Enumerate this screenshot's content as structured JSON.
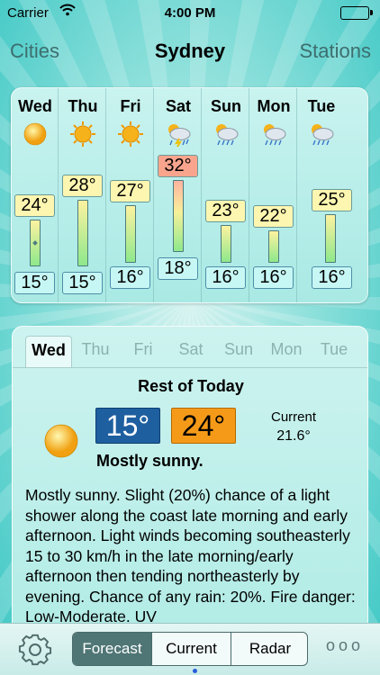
{
  "status_bar": {
    "carrier": "Carrier",
    "time": "4:00 PM"
  },
  "nav": {
    "left": "Cities",
    "title": "Sydney",
    "right": "Stations"
  },
  "week": [
    {
      "day": "Wed",
      "icon": "sun-icon",
      "high": "24°",
      "low": "15°"
    },
    {
      "day": "Thu",
      "icon": "sun-icon",
      "high": "28°",
      "low": "15°"
    },
    {
      "day": "Fri",
      "icon": "sun-icon",
      "high": "27°",
      "low": "16°"
    },
    {
      "day": "Sat",
      "icon": "thunderstorm-icon",
      "high": "32°",
      "low": "18°"
    },
    {
      "day": "Sun",
      "icon": "rain-cloud-icon",
      "high": "23°",
      "low": "16°"
    },
    {
      "day": "Mon",
      "icon": "rain-cloud-icon",
      "high": "22°",
      "low": "16°"
    },
    {
      "day": "Tue",
      "icon": "rain-cloud-icon",
      "high": "25°",
      "low": "16°"
    }
  ],
  "detail": {
    "tabs": [
      "Wed",
      "Thu",
      "Fri",
      "Sat",
      "Sun",
      "Mon",
      "Tue"
    ],
    "active_tab": "Wed",
    "period": "Rest of Today",
    "low": "15°",
    "high": "24°",
    "current_label": "Current",
    "current_value": "21.6°",
    "condition": "Mostly sunny.",
    "forecast": "Mostly sunny. Slight (20%) chance of a light shower along the coast late morning and early afternoon. Light winds becoming southeasterly 15 to 30 km/h in the late morning/early afternoon then tending northeasterly by evening. Chance of any rain: 20%. Fire danger: Low-Moderate. UV"
  },
  "tab_bar": {
    "forecast": "Forecast",
    "current": "Current",
    "radar": "Radar",
    "more": "ooo"
  },
  "colors": {
    "low_box": "#1e5fa0",
    "high_box": "#f59a18",
    "accent": "#4f7575"
  }
}
